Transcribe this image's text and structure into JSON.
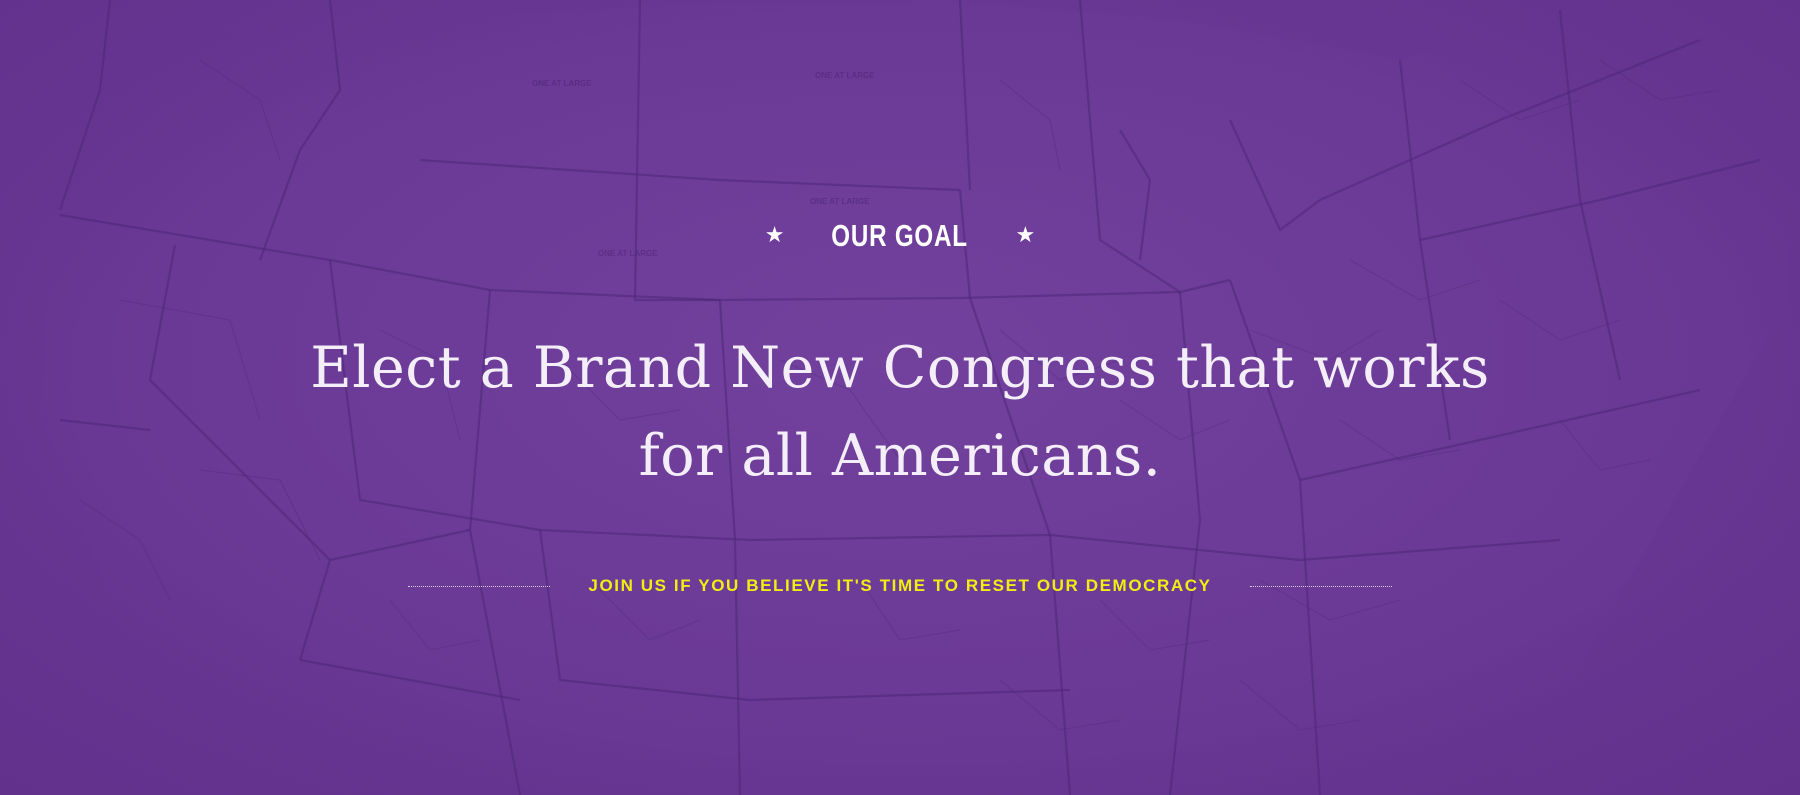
{
  "section": {
    "eyebrow": {
      "left_icon": "star-icon",
      "label": "OUR GOAL",
      "right_icon": "star-icon"
    },
    "headline": {
      "line1": "Elect a Brand New Congress that works",
      "line2": "for all Americans."
    },
    "tagline": "JOIN US IF YOU BELIEVE IT'S TIME TO RESET OUR DEMOCRACY",
    "map_labels": {
      "one_at_large_1": "ONE AT LARGE",
      "one_at_large_2": "ONE AT LARGE",
      "one_at_large_3": "ONE AT LARGE",
      "one_at_large_4": "ONE AT LARGE"
    }
  },
  "colors": {
    "background": "#66368f",
    "map_lines": "#4e2478",
    "headline_text": "#f4eef8",
    "tagline_text": "#f2ee12",
    "eyebrow_text": "#ffffff"
  }
}
